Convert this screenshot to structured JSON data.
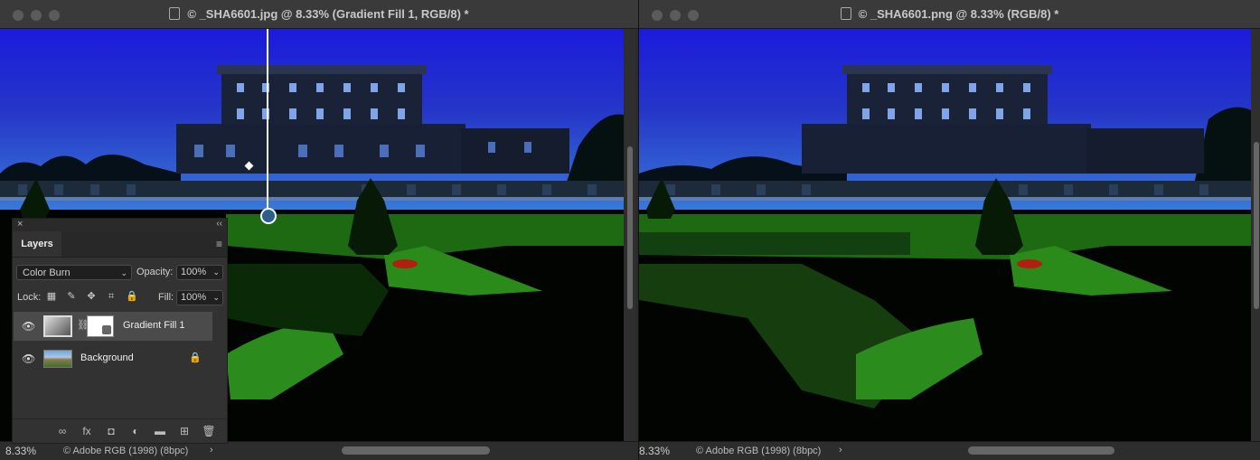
{
  "left_window": {
    "title": "© _SHA6601.jpg @ 8.33% (Gradient Fill 1, RGB/8) *",
    "zoom": "8.33%",
    "profile": "© Adobe RGB (1998) (8bpc)",
    "profile_arrow": "›"
  },
  "right_window": {
    "title": "© _SHA6601.png @ 8.33% (RGB/8) *",
    "zoom": "8.33%",
    "profile": "© Adobe RGB (1998) (8bpc)",
    "profile_arrow": "›"
  },
  "layers_panel": {
    "close": "×",
    "collapse": "‹‹",
    "tab_label": "Layers",
    "menu_icon": "≡",
    "blend_mode": "Color Burn",
    "opacity_label": "Opacity:",
    "opacity_value": "100%",
    "lock_label": "Lock:",
    "fill_label": "Fill:",
    "fill_value": "100%",
    "chevron": "⌄",
    "lock_icons": [
      "▦",
      "✎",
      "✥",
      "⌗",
      "🔒"
    ],
    "layers": [
      {
        "name": "Gradient Fill 1",
        "selected": true
      },
      {
        "name": "Background",
        "selected": false,
        "locked": true
      }
    ],
    "footer_icons": [
      "∞",
      "fx",
      "◘",
      "◐",
      "▬",
      "⊞",
      "🗑"
    ]
  },
  "colors": {
    "sky_top": "#1f1fd8",
    "grass": "#2e8a1c",
    "panel_bg": "#323232"
  }
}
